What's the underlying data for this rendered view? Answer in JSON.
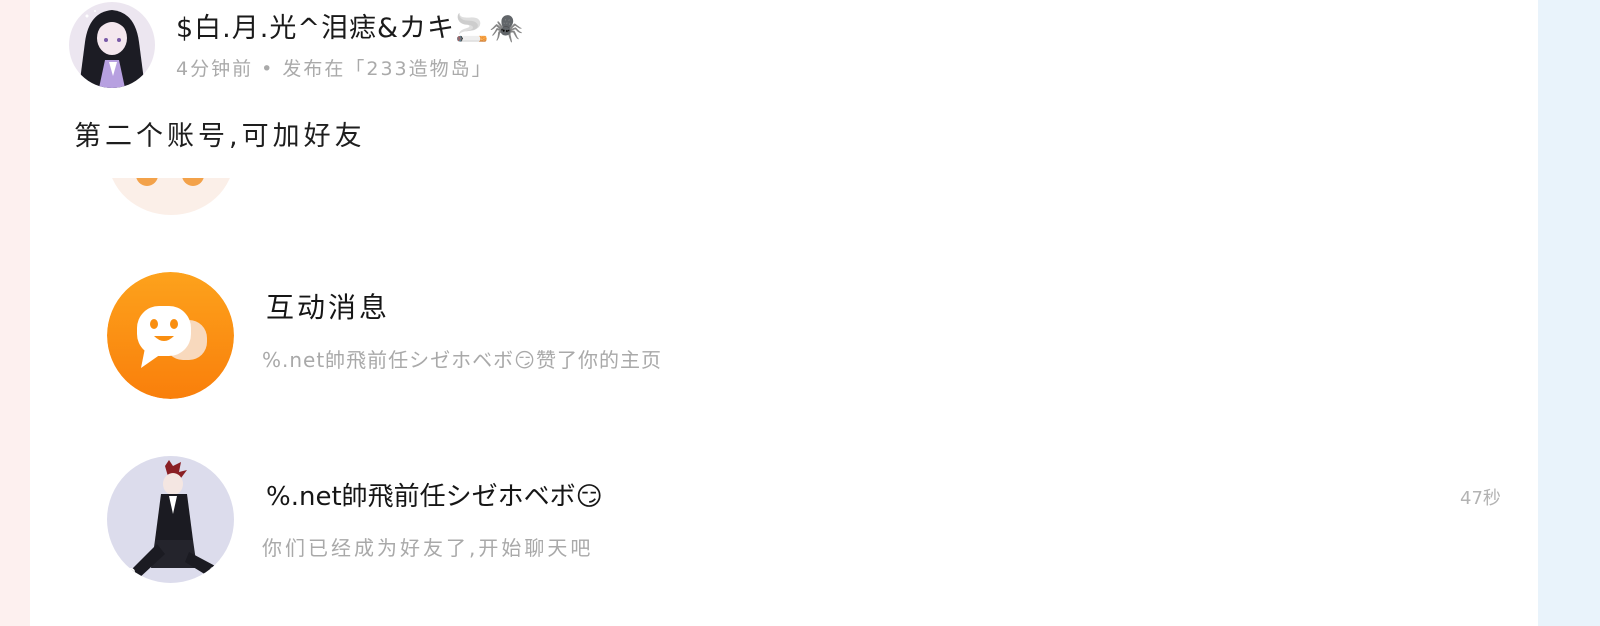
{
  "post": {
    "author": "$白.月.光^泪痣&カキ🚬🕷️",
    "meta": "4分钟前 • 发布在「233造物岛」",
    "text": "第二个账号,可加好友"
  },
  "messages": [
    {
      "title": "互动消息",
      "preview": "%.net帥飛前任シゼホベボ😏赞了你的主页",
      "avatar_icon": "chat-bubble-icon"
    },
    {
      "title": "%.net帥飛前任シゼホベボ😏",
      "preview": "你们已经成为好友了,开始聊天吧",
      "time": "47秒"
    }
  ],
  "colors": {
    "page_bg": "#fdf0ef",
    "card_bg": "#ffffff",
    "right_strip": "#e9f3fb",
    "orange": "#fb8c0f",
    "muted_text": "#a9a9a9"
  }
}
